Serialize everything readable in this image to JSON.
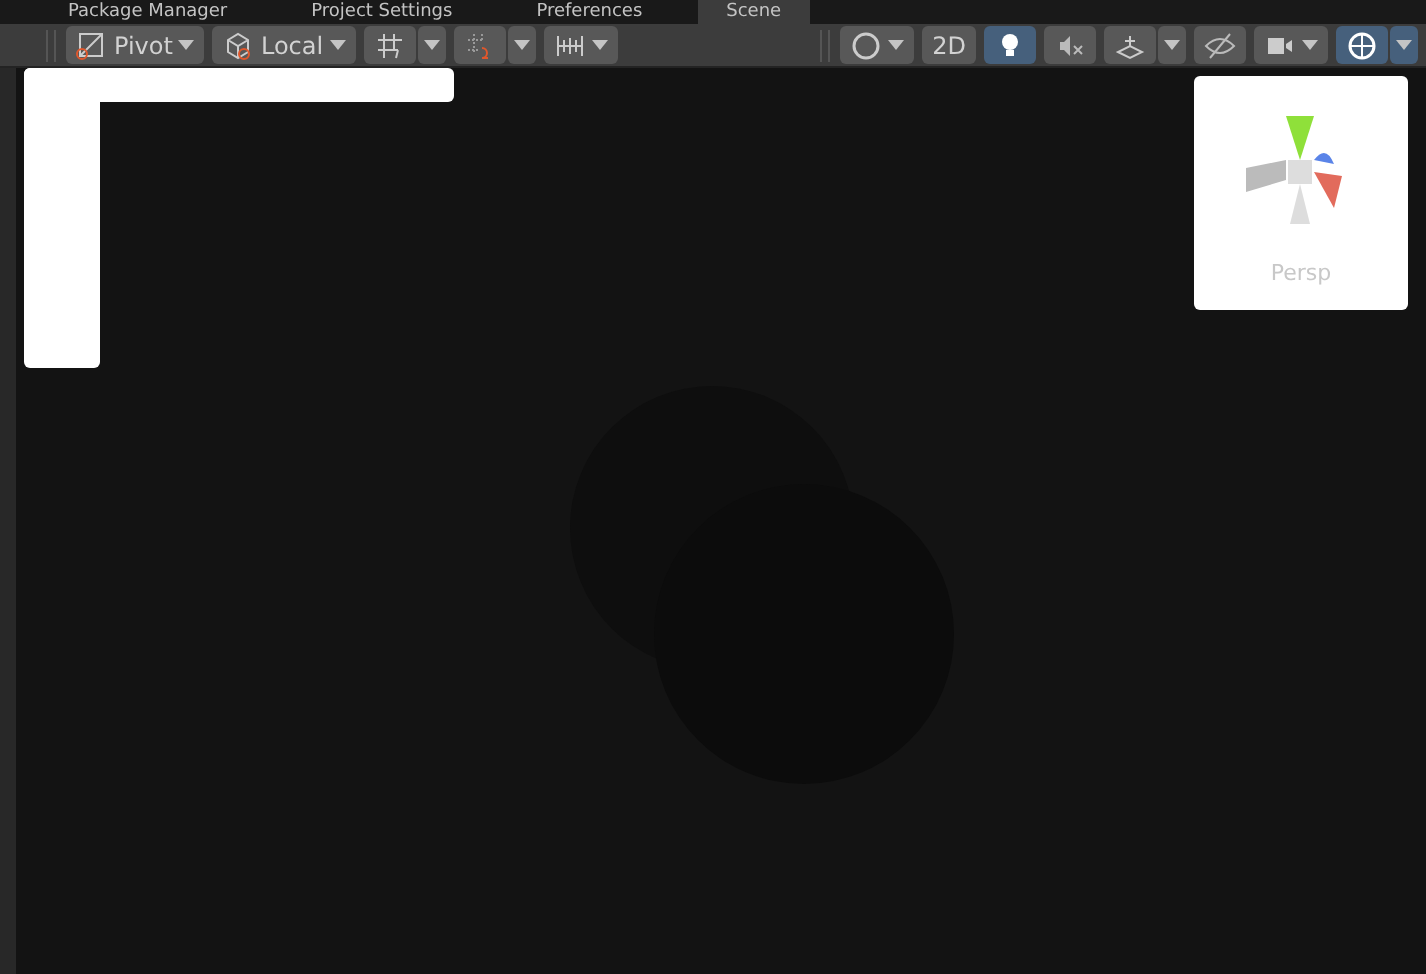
{
  "tabs": [
    {
      "label": "Package Manager",
      "selected": false
    },
    {
      "label": "Project Settings",
      "selected": false
    },
    {
      "label": "Preferences",
      "selected": false
    },
    {
      "label": "Scene",
      "selected": true
    }
  ],
  "toolbar_left": [
    {
      "kind": "dropdown",
      "label": "Pivot"
    },
    {
      "kind": "dropdown",
      "label": "Local"
    },
    {
      "kind": "split"
    },
    {
      "kind": "split"
    },
    {
      "kind": "dropdown"
    }
  ],
  "toolbar_right": [
    {
      "kind": "dropdown",
      "on": false
    },
    {
      "kind": "toggle",
      "label": "2D",
      "on": false
    },
    {
      "kind": "toggle",
      "on": true
    },
    {
      "kind": "toggle",
      "on": false
    },
    {
      "kind": "split",
      "on": false
    },
    {
      "kind": "toggle",
      "on": false
    },
    {
      "kind": "dropdown",
      "on": false
    },
    {
      "kind": "split",
      "on": true
    }
  ],
  "gizmo": {
    "label": "Persp"
  }
}
